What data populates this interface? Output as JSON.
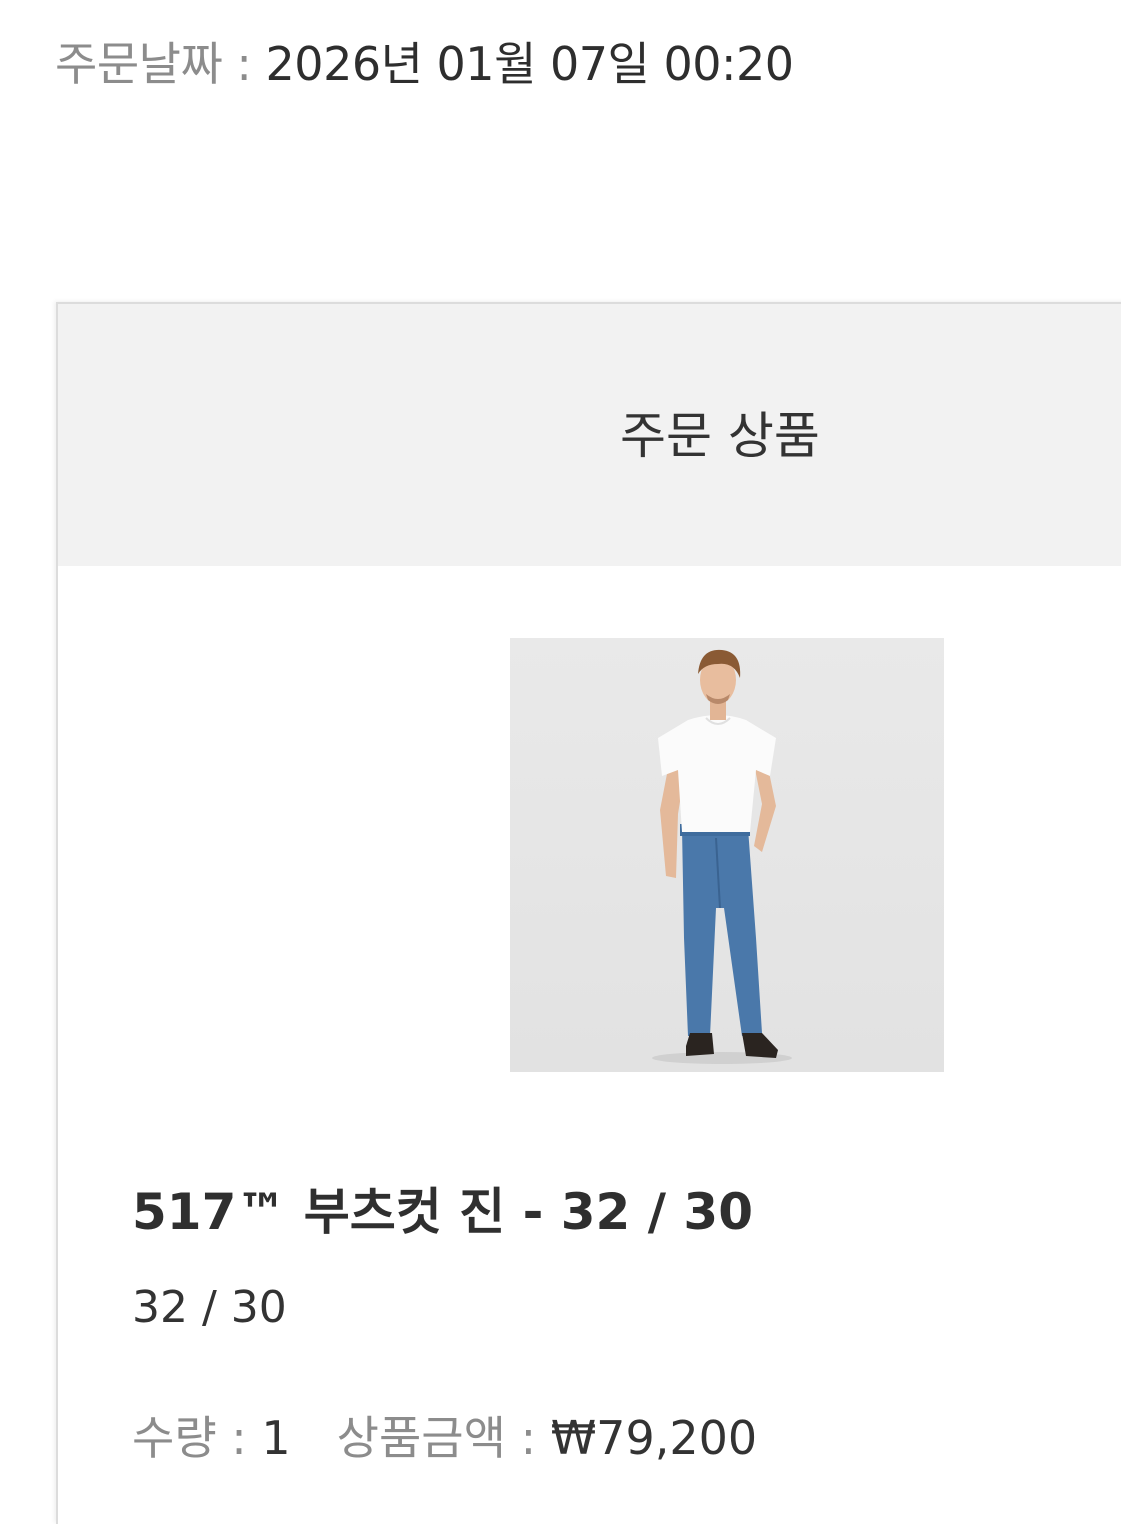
{
  "order": {
    "date_label": "주문날짜 : ",
    "date_value": "2026년 01월 07일 00:20"
  },
  "section": {
    "title": "주문 상품"
  },
  "product": {
    "image_alt": "517™ 부츠컷 진",
    "name": "517™ 부츠컷 진 - 32 / 30",
    "option": "32 / 30",
    "quantity_label": "수량 : ",
    "quantity_value": "1",
    "price_label": "상품금액 : ",
    "price_value": "₩79,200"
  },
  "colors": {
    "label_gray": "#8c8c8c",
    "text_dark": "#2e2e2e",
    "header_bg": "#f2f2f2",
    "denim": "#4a78aa"
  }
}
